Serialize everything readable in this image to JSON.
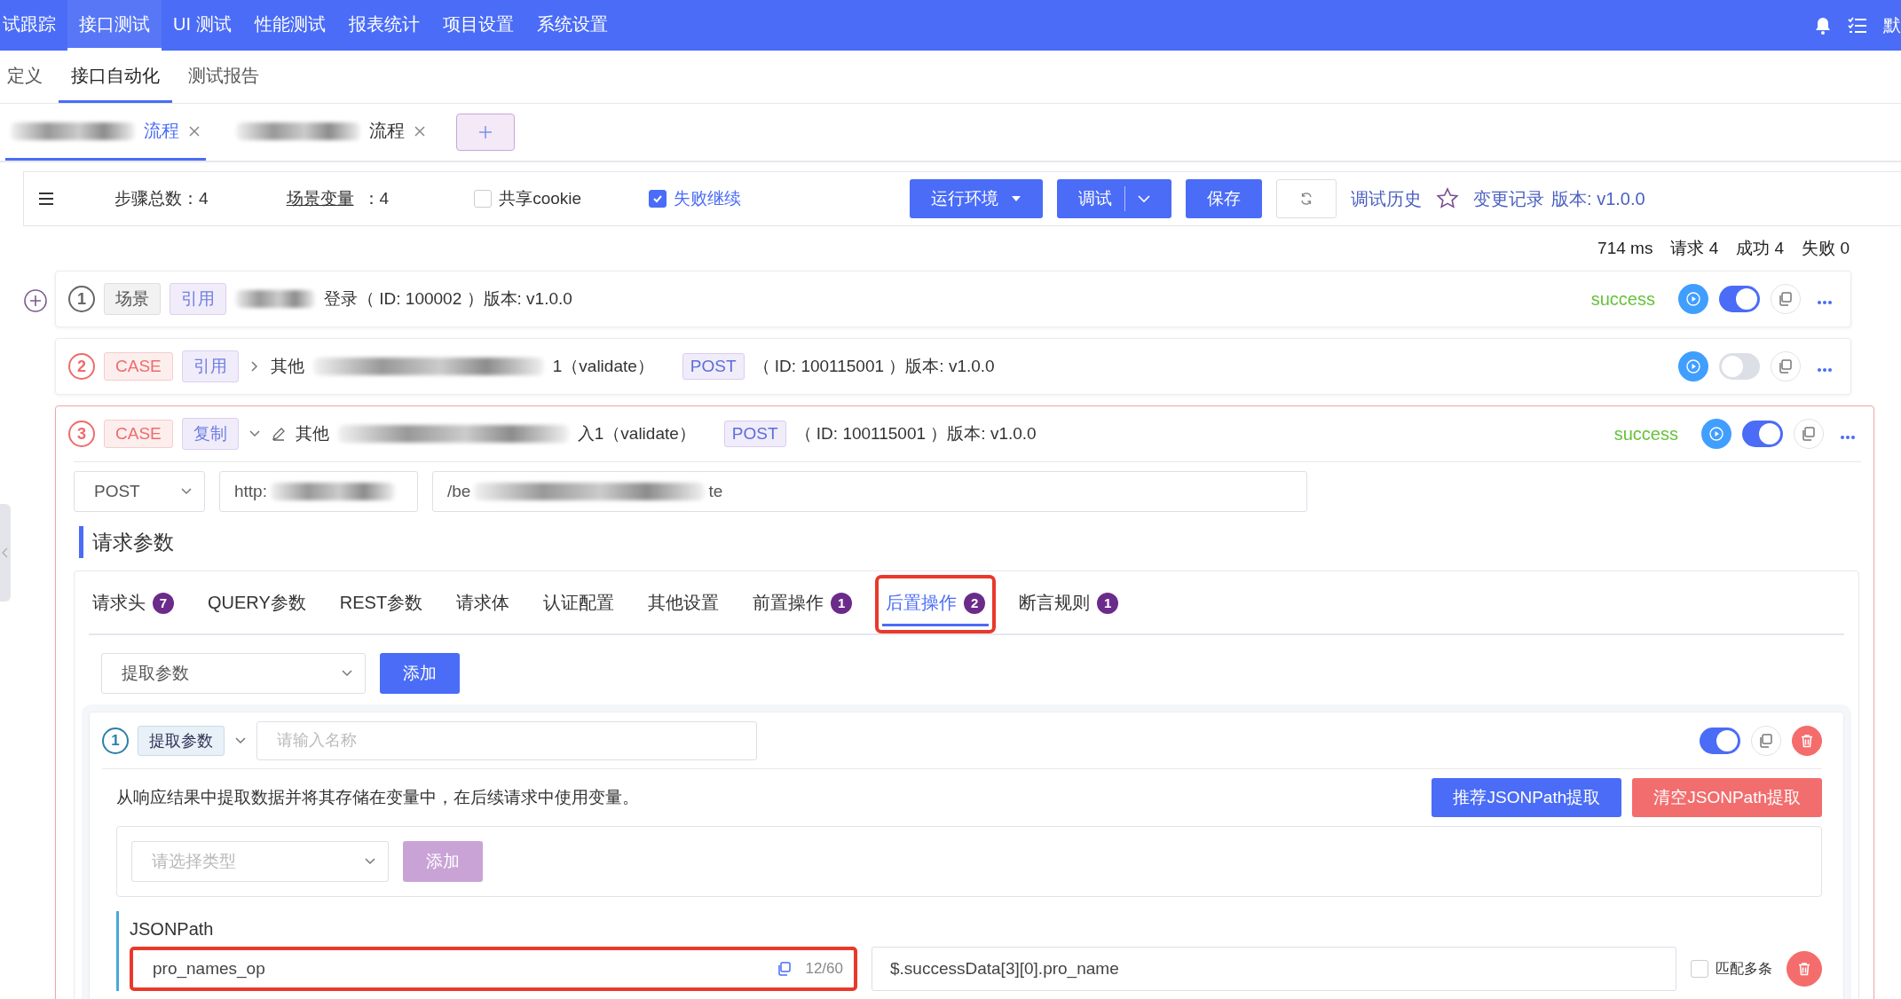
{
  "top_nav": {
    "items": [
      {
        "label": "试跟踪",
        "selected": false
      },
      {
        "label": "接口测试",
        "selected": true
      },
      {
        "label": "UI 测试",
        "selected": false
      },
      {
        "label": "性能测试",
        "selected": false
      },
      {
        "label": "报表统计",
        "selected": false
      },
      {
        "label": "项目设置",
        "selected": false
      },
      {
        "label": "系统设置",
        "selected": false
      }
    ],
    "user": "默"
  },
  "sub_nav": [
    {
      "label": "定义",
      "selected": false
    },
    {
      "label": "接口自动化",
      "selected": true
    },
    {
      "label": "测试报告",
      "selected": false
    }
  ],
  "editor_tabs": [
    {
      "label": "流程",
      "masked": true,
      "selected": true
    },
    {
      "label": "流程",
      "masked": true,
      "selected": false
    }
  ],
  "toolbar": {
    "step_count": "步骤总数：4",
    "variables_label": "场景变量",
    "variables_value": "：4",
    "options": [
      {
        "label": "共享cookie",
        "checked": false
      },
      {
        "label": "失败继续",
        "checked": true
      }
    ],
    "env_button": "运行环境",
    "debug_button": "调试",
    "save_button": "保存",
    "history_link": "调试历史",
    "changes_link": "变更记录",
    "version": "版本: v1.0.0"
  },
  "stats": [
    "714 ms",
    "请求 4",
    "成功 4",
    "失败 0"
  ],
  "steps": [
    {
      "number": "1",
      "kind": "scene",
      "type_tag": "场景",
      "source_tag": "引用",
      "masked": true,
      "name_after": "登录（ ID: 100002 ）版本: v1.0.0",
      "status": "success",
      "enabled": true
    },
    {
      "number": "2",
      "kind": "case",
      "type_tag": "CASE",
      "source_tag": "引用",
      "expanded": false,
      "name_before": "其他",
      "masked": true,
      "name_after": "1（validate）",
      "method": "POST",
      "id_text": "（ ID: 100115001 ）版本: v1.0.0",
      "enabled": false
    },
    {
      "number": "3",
      "kind": "case",
      "type_tag": "CASE",
      "source_tag": "复制",
      "expanded": true,
      "editable": true,
      "name_before": "其他",
      "masked": true,
      "name_after": "入1（validate）",
      "method": "POST",
      "id_text": "（ ID: 100115001 ）版本: v1.0.0",
      "status": "success",
      "enabled": true
    }
  ],
  "detail": {
    "method": "POST",
    "host": "http:",
    "path": "/be",
    "path_end": "te",
    "section_title": "请求参数",
    "tabs": [
      {
        "label": "请求头",
        "count": "7",
        "selected": false
      },
      {
        "label": "QUERY参数",
        "selected": false
      },
      {
        "label": "REST参数",
        "selected": false
      },
      {
        "label": "请求体",
        "selected": false
      },
      {
        "label": "认证配置",
        "selected": false
      },
      {
        "label": "其他设置",
        "selected": false
      },
      {
        "label": "前置操作",
        "count": "1",
        "selected": false
      },
      {
        "label": "后置操作",
        "count": "2",
        "selected": true,
        "highlighted": true
      },
      {
        "label": "断言规则",
        "count": "1",
        "selected": false
      }
    ],
    "action_select": "提取参数",
    "add_button": "添加",
    "processor": {
      "number": "1",
      "tag": "提取参数",
      "name_placeholder": "请输入名称",
      "enabled": true,
      "description": "从响应结果中提取数据并将其存储在变量中，在后续请求中使用变量。",
      "suggest_button": "推荐JSONPath提取",
      "clear_button": "清空JSONPath提取",
      "type_placeholder": "请选择类型",
      "type_add_button": "添加",
      "extractor": {
        "label": "JSONPath",
        "variable": "pro_names_op",
        "highlighted": true,
        "counter": "12/60",
        "expression": "$.successData[3][0].pro_name",
        "match_multiple": {
          "label": "匹配多条",
          "checked": false
        }
      }
    }
  }
}
